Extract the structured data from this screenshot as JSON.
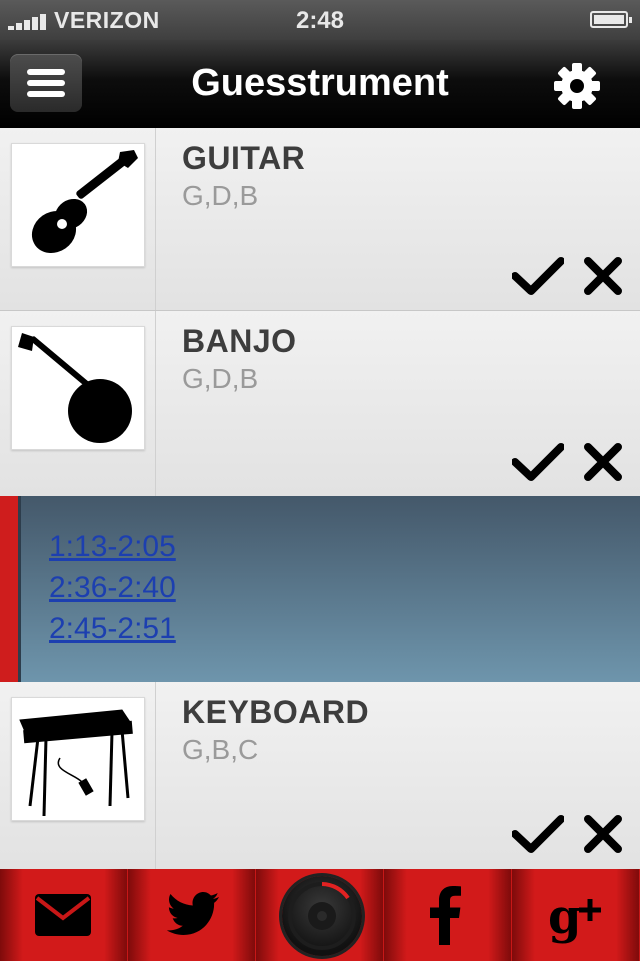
{
  "status_bar": {
    "carrier": "VERIZON",
    "time": "2:48"
  },
  "nav": {
    "title": "Guesstrument",
    "menu_icon": "hamburger-icon",
    "settings_icon": "gear-icon"
  },
  "instruments": [
    {
      "name": "GUITAR",
      "chords": "G,D,B",
      "image": "guitar-silhouette"
    },
    {
      "name": "BANJO",
      "chords": "G,D,B",
      "image": "banjo-silhouette"
    },
    {
      "name": "KEYBOARD",
      "chords": "G,B,C",
      "image": "keyboard-silhouette"
    }
  ],
  "expanded_panel": {
    "timestamps": [
      "1:13-2:05",
      "2:36-2:40",
      "2:45-2:51"
    ]
  },
  "tab_bar": {
    "items": [
      "mail-icon",
      "twitter-icon",
      "record-icon",
      "facebook-icon",
      "google-plus-icon"
    ]
  },
  "colors": {
    "accent_red": "#c81717",
    "panel_blue": "#5b7f96",
    "link_blue": "#1c3fb0"
  }
}
